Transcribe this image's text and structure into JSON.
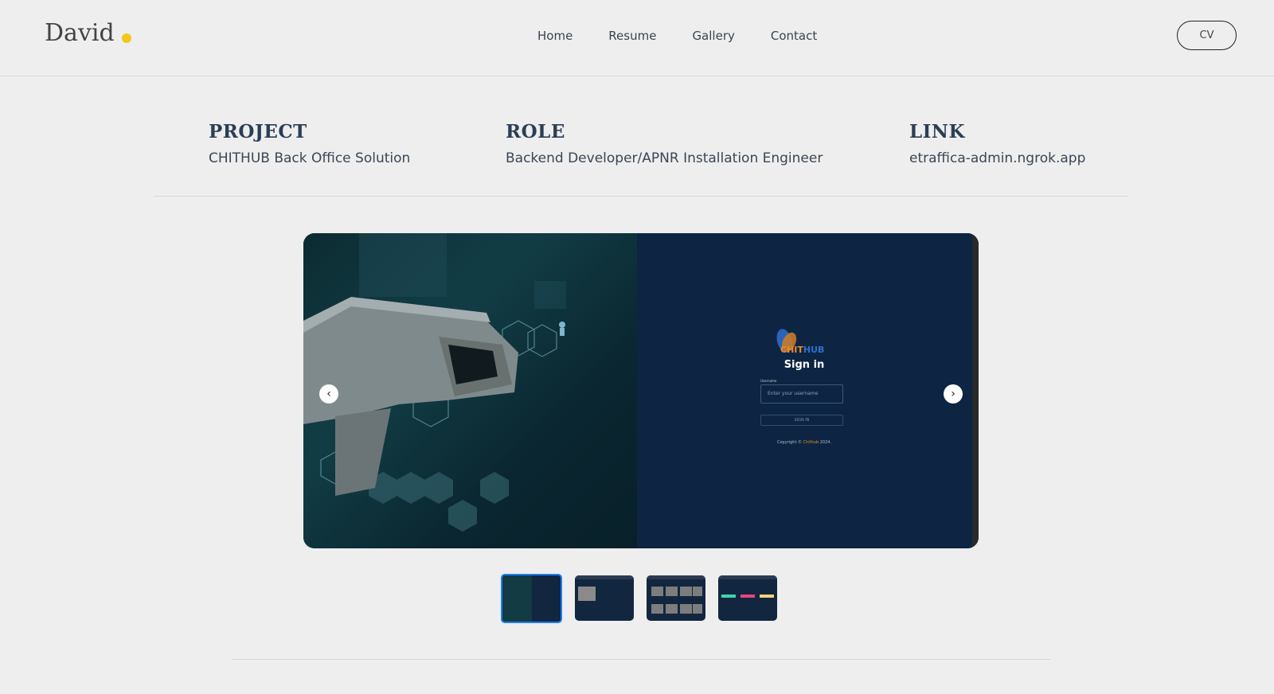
{
  "brand": {
    "name": "David",
    "dot_color": "#f5c518"
  },
  "nav": {
    "items": [
      "Home",
      "Resume",
      "Gallery",
      "Contact"
    ]
  },
  "cv_button": "CV",
  "project": {
    "project_label": "PROJECT",
    "project_value": "CHITHUB Back Office Solution",
    "role_label": "ROLE",
    "role_value": "Backend Developer/APNR Installation Engineer",
    "link_label": "LINK",
    "link_value": "etraffica-admin.ngrok.app"
  },
  "slider": {
    "login": {
      "logo_part1": "CHIT",
      "logo_part2": "HUB",
      "title": "Sign in",
      "field_label": "Username",
      "field_placeholder": "Enter your username",
      "button": "SIGN IN",
      "copyright_prefix": "Copyright © ",
      "copyright_brand": "Chithub",
      "copyright_suffix": " 2024."
    },
    "prev_icon": "chevron-left-icon",
    "next_icon": "chevron-right-icon",
    "active_slide": 1,
    "slide_count": 4
  },
  "colors": {
    "accent": "#1e7ef0",
    "slide_bg": "#0d2543",
    "logo_orange": "#e88b2a",
    "logo_blue": "#2f6fcc"
  }
}
